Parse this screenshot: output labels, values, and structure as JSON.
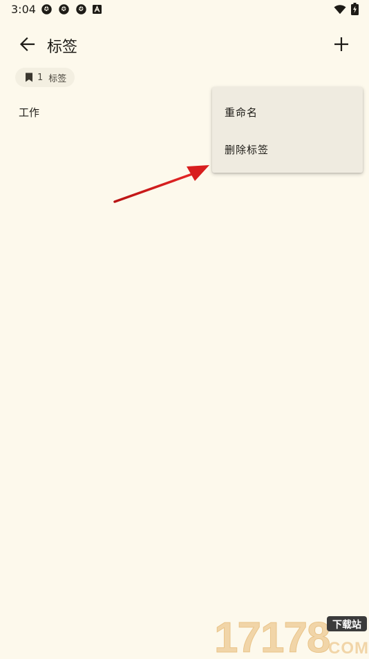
{
  "status_bar": {
    "time": "3:04",
    "notification_icons": [
      "aperture-icon",
      "aperture-icon",
      "aperture-icon",
      "a-box-icon"
    ],
    "right_icons": [
      "wifi-icon",
      "battery-charging-icon"
    ]
  },
  "app_bar": {
    "title": "标签",
    "back_icon": "arrow-left-icon",
    "add_icon": "plus-icon"
  },
  "summary_chip": {
    "icon": "bookmark-icon",
    "count": "1",
    "label": "标签"
  },
  "tags": [
    {
      "name": "工作"
    }
  ],
  "context_menu": {
    "items": [
      {
        "label": "重命名"
      },
      {
        "label": "删除标签"
      }
    ]
  },
  "watermark": {
    "number": "17178",
    "tag": "下载站",
    "domain": "COM"
  },
  "colors": {
    "background": "#fdf9ec",
    "menu_background": "#efebe0",
    "chip_background": "#f3efe1",
    "text": "#1d1b16",
    "annotation_arrow": "#d81e1e"
  }
}
